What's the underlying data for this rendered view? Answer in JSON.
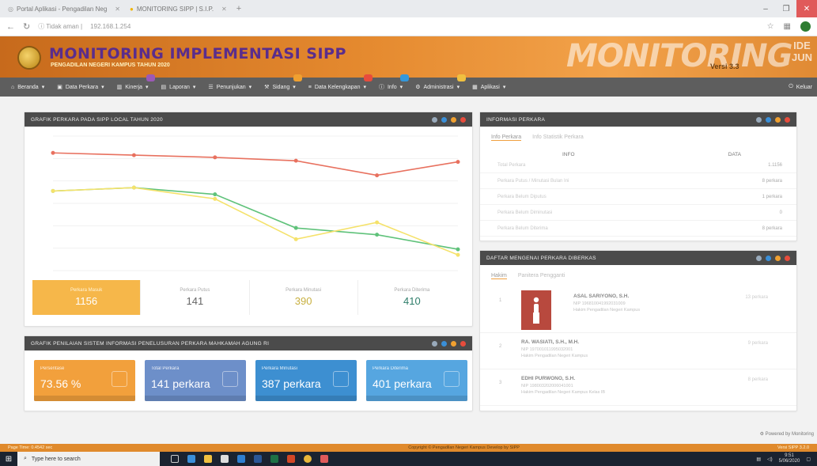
{
  "browser": {
    "tabs": [
      {
        "label": "Portal Aplikasi - Pengadilan Neg",
        "color": "#9aa0a6"
      },
      {
        "label": "MONITORING SIPP | S.I.P.",
        "color": "#f0b400"
      }
    ],
    "new_tab": "+",
    "url_prefix": "Tidak aman",
    "url": "192.168.1.254",
    "win_min": "–",
    "win_max": "❐",
    "win_close": "✕"
  },
  "banner": {
    "title": "MONITORING IMPLEMENTASI SIPP",
    "subtitle": "PENGADILAN NEGERI KAMPUS TAHUN 2020",
    "big_text": "MONITORING",
    "version": "Versi 3.3",
    "side_text": "IDE JUN"
  },
  "menu": {
    "items": [
      {
        "label": "Beranda",
        "icon": "home-icon",
        "badge": ""
      },
      {
        "label": "Data Perkara",
        "icon": "folder-icon",
        "badge": ""
      },
      {
        "label": "Kinerja",
        "icon": "chart-icon",
        "badge": "#9b59b6"
      },
      {
        "label": "Laporan",
        "icon": "file-icon",
        "badge": ""
      },
      {
        "label": "Penunjukan",
        "icon": "users-icon",
        "badge": ""
      },
      {
        "label": "Sidang",
        "icon": "gavel-icon",
        "badge": "#f0a030"
      },
      {
        "label": "Data Kelengkapan",
        "icon": "list-icon",
        "badge": "#e74c3c"
      },
      {
        "label": "Info",
        "icon": "info-icon",
        "badge": "#3498db"
      },
      {
        "label": "Administrasi",
        "icon": "gear-icon",
        "badge": "#f0c040"
      },
      {
        "label": "Aplikasi",
        "icon": "grid-icon",
        "badge": ""
      }
    ],
    "right_label": "Keluar"
  },
  "chart_panel": {
    "title": "GRAFIK PERKARA PADA SIPP LOCAL TAHUN 2020",
    "kpis": [
      {
        "label": "Perkara Masuk",
        "value": "1156",
        "color": "#ffffff"
      },
      {
        "label": "Perkara Putus",
        "value": "141",
        "color": "#666666"
      },
      {
        "label": "Perkara Minutasi",
        "value": "390",
        "color": "#c8b040"
      },
      {
        "label": "Perkara Diterima",
        "value": "410",
        "color": "#2e7d6a"
      }
    ]
  },
  "chart_data": {
    "type": "line",
    "categories": [
      "",
      "",
      "",
      "",
      "",
      ""
    ],
    "series": [
      {
        "color": "#e8715f",
        "values": [
          105,
          103,
          101,
          98,
          85,
          97
        ]
      },
      {
        "color": "#5fc27a",
        "values": [
          71,
          74,
          68,
          38,
          32,
          19
        ]
      },
      {
        "color": "#f5e26b",
        "values": [
          71,
          74,
          64,
          28,
          43,
          14
        ]
      }
    ],
    "ylim": [
      0,
      120
    ],
    "grid": true
  },
  "stats_panel": {
    "title": "GRAFIK PENILAIAN SISTEM INFORMASI PENELUSURAN PERKARA MAHKAMAH AGUNG RI",
    "cards": [
      {
        "label": "Persentase",
        "value": "73.56 %",
        "color": "#f2a03c"
      },
      {
        "label": "Total Perkara",
        "value": "141 perkara",
        "color": "#6d8fc9"
      },
      {
        "label": "Perkara Minutasi",
        "value": "387 perkara",
        "color": "#3d8fd1"
      },
      {
        "label": "Perkara Diterima",
        "value": "401 perkara",
        "color": "#56a6e0"
      }
    ]
  },
  "info_panel": {
    "title": "INFORMASI PERKARA",
    "tabs": [
      "Info Perkara",
      "Info Statistik Perkara"
    ],
    "col_info": "INFO",
    "col_data": "DATA",
    "rows": [
      {
        "label": "Total Perkara",
        "value": "1.1156"
      },
      {
        "label": "Perkara Putus / Minutasi Bulan Ini",
        "value": "8 perkara"
      },
      {
        "label": "Perkara Belum Diputus",
        "value": "1 perkara"
      },
      {
        "label": "Perkara Belum Diminutasi",
        "value": "0"
      },
      {
        "label": "Perkara Belum Diterima",
        "value": "8 perkara"
      }
    ]
  },
  "judge_panel": {
    "title": "DAFTAR MENGENAI PERKARA DIBERKAS",
    "tabs": [
      "Hakim",
      "Panitera Pengganti"
    ],
    "people": [
      {
        "no": "1",
        "name": "ASAL SARIYONO, S.H.",
        "line2": "NIP 196810041992031009",
        "line3": "Hakim Pengadilan Negeri Kampus",
        "count": "13 perkara"
      },
      {
        "no": "2",
        "name": "RA. WASIATI, S.H., M.H.",
        "line2": "NIP 197001011995032001",
        "line3": "Hakim Pengadilan Negeri Kampus",
        "count": "9 perkara"
      },
      {
        "no": "3",
        "name": "EDHI PURWONO, S.H.",
        "line2": "NIP 198003202006041001",
        "line3": "Hakim Pengadilan Negeri Kampus Kelas IB",
        "count": "8 perkara"
      }
    ]
  },
  "footer": {
    "left": "Page Time: 0.4542 sec",
    "mid": "Copyright © Pengadilan Negeri Kampus  Develop by SIPP",
    "right": "Versi SIPP 3.2.0"
  },
  "powered": "Powered by Monitoring",
  "taskbar": {
    "search_placeholder": "Type here to search",
    "time": "9:51",
    "date": "5/06/2020"
  }
}
